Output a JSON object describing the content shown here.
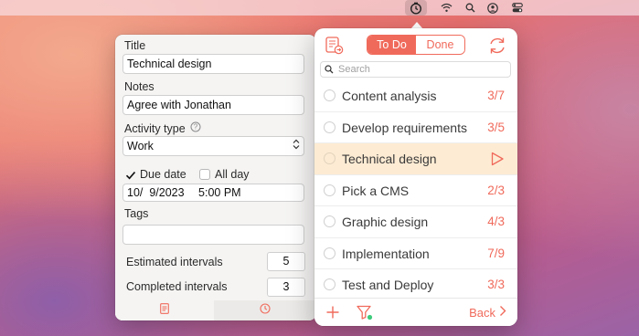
{
  "menubar": {
    "icons": [
      "timer-app-icon",
      "wifi-icon",
      "search-icon",
      "user-account-icon",
      "control-center-icon"
    ]
  },
  "detail": {
    "title_label": "Title",
    "title_value": "Technical design",
    "notes_label": "Notes",
    "notes_value": "Agree with Jonathan",
    "activity_label": "Activity type",
    "activity_help_icon": "question-circle-icon",
    "activity_value": "Work",
    "due_date_label": "Due date",
    "due_date_checked": true,
    "all_day_label": "All day",
    "all_day_checked": false,
    "date_value": "10/  9/2023",
    "time_value": "5:00 PM",
    "tags_label": "Tags",
    "tags_value": "",
    "estimated_label": "Estimated intervals",
    "estimated_value": "5",
    "completed_label": "Completed intervals",
    "completed_value": "3",
    "tabs": [
      "notes-tab",
      "timer-tab"
    ]
  },
  "popover": {
    "toggle": {
      "todo": "To Do",
      "done": "Done",
      "selected": "todo"
    },
    "search_placeholder": "Search",
    "tasks": [
      {
        "title": "Content analysis",
        "count": "3/7",
        "selected": false
      },
      {
        "title": "Develop requirements",
        "count": "3/5",
        "selected": false
      },
      {
        "title": "Technical design",
        "count": "",
        "selected": true
      },
      {
        "title": "Pick a CMS",
        "count": "2/3",
        "selected": false
      },
      {
        "title": "Graphic design",
        "count": "4/3",
        "selected": false
      },
      {
        "title": "Implementation",
        "count": "7/9",
        "selected": false
      },
      {
        "title": "Test and Deploy",
        "count": "3/3",
        "selected": false
      }
    ],
    "back_label": "Back"
  },
  "colors": {
    "accent": "#f06a5b",
    "selected_row": "#fdebd3"
  }
}
